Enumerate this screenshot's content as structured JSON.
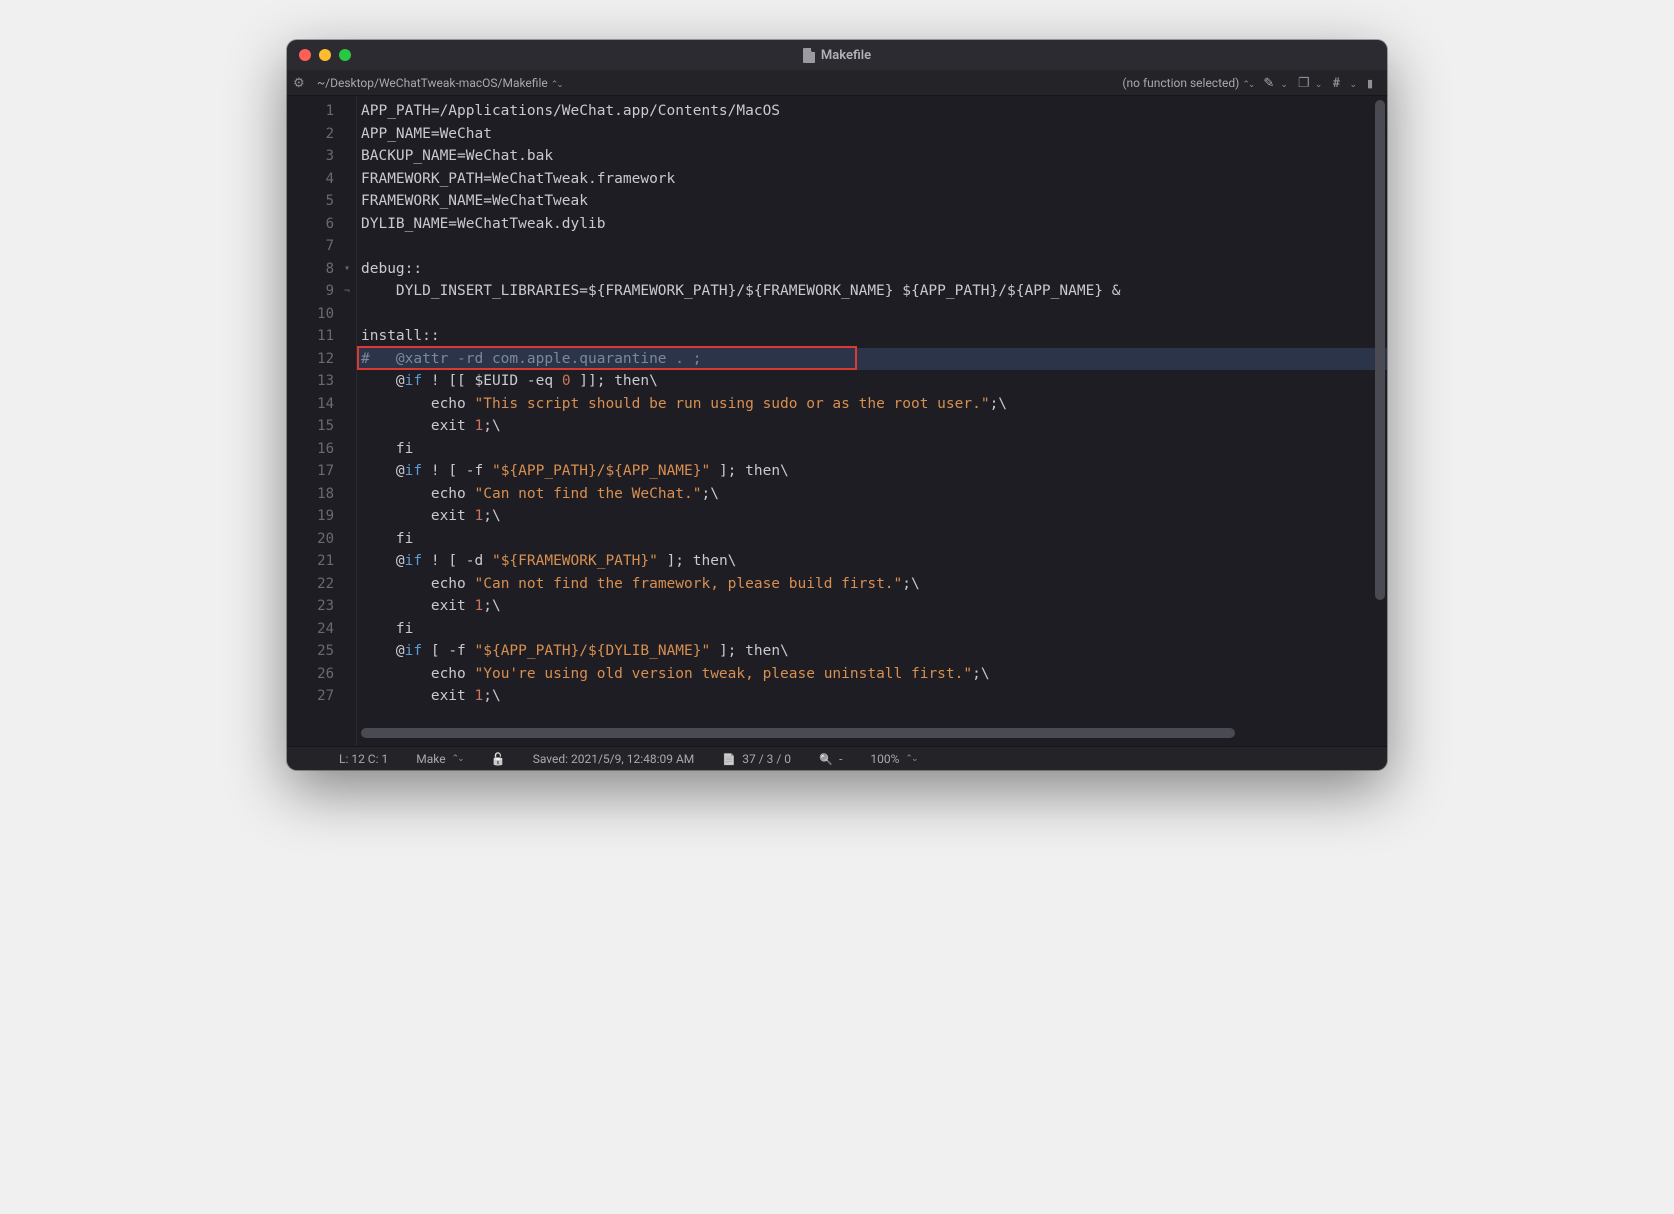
{
  "window": {
    "title": "Makefile"
  },
  "pathbar": {
    "path": "~/Desktop/WeChatTweak-macOS/Makefile",
    "function_selector": "(no function selected)"
  },
  "editor": {
    "highlighted_line": 12,
    "lines": [
      {
        "n": 1,
        "tokens": [
          {
            "c": "plain",
            "t": "APP_PATH=/Applications/WeChat.app/Contents/MacOS"
          }
        ]
      },
      {
        "n": 2,
        "tokens": [
          {
            "c": "plain",
            "t": "APP_NAME=WeChat"
          }
        ]
      },
      {
        "n": 3,
        "tokens": [
          {
            "c": "plain",
            "t": "BACKUP_NAME=WeChat.bak"
          }
        ]
      },
      {
        "n": 4,
        "tokens": [
          {
            "c": "plain",
            "t": "FRAMEWORK_PATH=WeChatTweak.framework"
          }
        ]
      },
      {
        "n": 5,
        "tokens": [
          {
            "c": "plain",
            "t": "FRAMEWORK_NAME=WeChatTweak"
          }
        ]
      },
      {
        "n": 6,
        "tokens": [
          {
            "c": "plain",
            "t": "DYLIB_NAME=WeChatTweak.dylib"
          }
        ]
      },
      {
        "n": 7,
        "tokens": []
      },
      {
        "n": 8,
        "fold": "down",
        "tokens": [
          {
            "c": "plain",
            "t": "debug::"
          }
        ]
      },
      {
        "n": 9,
        "fold": "corner",
        "tokens": [
          {
            "c": "plain",
            "t": "    DYLD_INSERT_LIBRARIES=${FRAMEWORK_PATH}/${FRAMEWORK_NAME} ${APP_PATH}/${APP_NAME} &"
          }
        ]
      },
      {
        "n": 10,
        "tokens": []
      },
      {
        "n": 11,
        "tokens": [
          {
            "c": "plain",
            "t": "install::"
          }
        ]
      },
      {
        "n": 12,
        "tokens": [
          {
            "c": "comment",
            "t": "#   @xattr -rd com.apple.quarantine . ;"
          }
        ]
      },
      {
        "n": 13,
        "tokens": [
          {
            "c": "plain",
            "t": "    @"
          },
          {
            "c": "kw",
            "t": "if"
          },
          {
            "c": "plain",
            "t": " ! [[ $EUID -eq "
          },
          {
            "c": "num",
            "t": "0"
          },
          {
            "c": "plain",
            "t": " ]]; then\\"
          }
        ]
      },
      {
        "n": 14,
        "tokens": [
          {
            "c": "plain",
            "t": "        echo "
          },
          {
            "c": "str",
            "t": "\"This script should be run using sudo or as the root user.\""
          },
          {
            "c": "plain",
            "t": ";\\"
          }
        ]
      },
      {
        "n": 15,
        "tokens": [
          {
            "c": "plain",
            "t": "        exit "
          },
          {
            "c": "num",
            "t": "1"
          },
          {
            "c": "plain",
            "t": ";\\"
          }
        ]
      },
      {
        "n": 16,
        "tokens": [
          {
            "c": "plain",
            "t": "    fi"
          }
        ]
      },
      {
        "n": 17,
        "tokens": [
          {
            "c": "plain",
            "t": "    @"
          },
          {
            "c": "kw",
            "t": "if"
          },
          {
            "c": "plain",
            "t": " ! [ -f "
          },
          {
            "c": "str",
            "t": "\"${APP_PATH}/${APP_NAME}\""
          },
          {
            "c": "plain",
            "t": " ]; then\\"
          }
        ]
      },
      {
        "n": 18,
        "tokens": [
          {
            "c": "plain",
            "t": "        echo "
          },
          {
            "c": "str",
            "t": "\"Can not find the WeChat.\""
          },
          {
            "c": "plain",
            "t": ";\\"
          }
        ]
      },
      {
        "n": 19,
        "tokens": [
          {
            "c": "plain",
            "t": "        exit "
          },
          {
            "c": "num",
            "t": "1"
          },
          {
            "c": "plain",
            "t": ";\\"
          }
        ]
      },
      {
        "n": 20,
        "tokens": [
          {
            "c": "plain",
            "t": "    fi"
          }
        ]
      },
      {
        "n": 21,
        "tokens": [
          {
            "c": "plain",
            "t": "    @"
          },
          {
            "c": "kw",
            "t": "if"
          },
          {
            "c": "plain",
            "t": " ! [ -d "
          },
          {
            "c": "str",
            "t": "\"${FRAMEWORK_PATH}\""
          },
          {
            "c": "plain",
            "t": " ]; then\\"
          }
        ]
      },
      {
        "n": 22,
        "tokens": [
          {
            "c": "plain",
            "t": "        echo "
          },
          {
            "c": "str",
            "t": "\"Can not find the framework, please build first.\""
          },
          {
            "c": "plain",
            "t": ";\\"
          }
        ]
      },
      {
        "n": 23,
        "tokens": [
          {
            "c": "plain",
            "t": "        exit "
          },
          {
            "c": "num",
            "t": "1"
          },
          {
            "c": "plain",
            "t": ";\\"
          }
        ]
      },
      {
        "n": 24,
        "tokens": [
          {
            "c": "plain",
            "t": "    fi"
          }
        ]
      },
      {
        "n": 25,
        "tokens": [
          {
            "c": "plain",
            "t": "    @"
          },
          {
            "c": "kw",
            "t": "if"
          },
          {
            "c": "plain",
            "t": " [ -f "
          },
          {
            "c": "str",
            "t": "\"${APP_PATH}/${DYLIB_NAME}\""
          },
          {
            "c": "plain",
            "t": " ]; then\\"
          }
        ]
      },
      {
        "n": 26,
        "tokens": [
          {
            "c": "plain",
            "t": "        echo "
          },
          {
            "c": "str",
            "t": "\"You're using old version tweak, please uninstall first.\""
          },
          {
            "c": "plain",
            "t": ";\\"
          }
        ]
      },
      {
        "n": 27,
        "tokens": [
          {
            "c": "plain",
            "t": "        exit "
          },
          {
            "c": "num",
            "t": "1"
          },
          {
            "c": "plain",
            "t": ";\\"
          }
        ]
      }
    ]
  },
  "status": {
    "cursor": "L: 12 C: 1",
    "language": "Make",
    "saved": "Saved: 2021/5/9, 12:48:09 AM",
    "counts": "37 / 3 / 0",
    "search": "-",
    "zoom": "100%"
  }
}
